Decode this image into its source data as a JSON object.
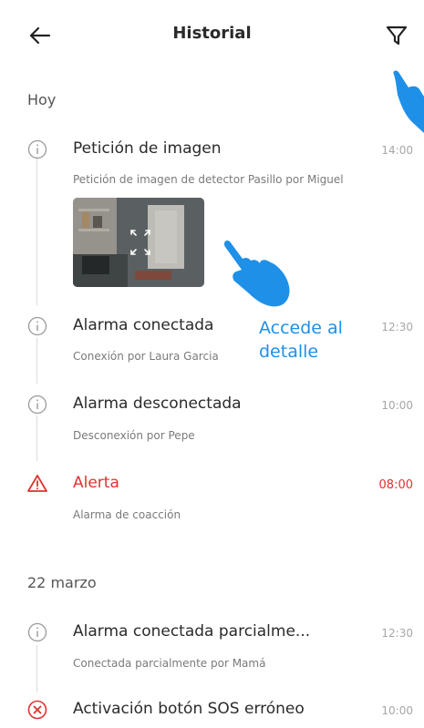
{
  "header": {
    "title": "Historial"
  },
  "sections": [
    {
      "label": "Hoy"
    },
    {
      "label": "22 marzo"
    }
  ],
  "events": [
    {
      "title": "Petición de imagen",
      "subtitle": "Petición de imagen de detector Pasillo por Miguel",
      "time": "14:00",
      "icon": "info-icon"
    },
    {
      "title": "Alarma conectada",
      "subtitle": "Conexión por Laura Garcia",
      "time": "12:30",
      "icon": "info-icon"
    },
    {
      "title": "Alarma desconectada",
      "subtitle": "Desconexión por Pepe",
      "time": "10:00",
      "icon": "info-icon"
    },
    {
      "title": "Alerta",
      "subtitle": "Alarma de coacción",
      "time": "08:00",
      "icon": "warning-icon"
    },
    {
      "title": "Alarma conectada parcialme...",
      "subtitle": "Conectada parcialmente por Mamá",
      "time": "12:30",
      "icon": "info-icon"
    },
    {
      "title": "Activación botón SOS erróneo",
      "subtitle": "",
      "time": "10:00",
      "icon": "error-icon"
    }
  ],
  "overlay": {
    "line1": "Accede al",
    "line2": "detalle"
  },
  "colors": {
    "accent": "#1e90e8",
    "alert": "#e0312f",
    "hand": "#1e90e8"
  }
}
